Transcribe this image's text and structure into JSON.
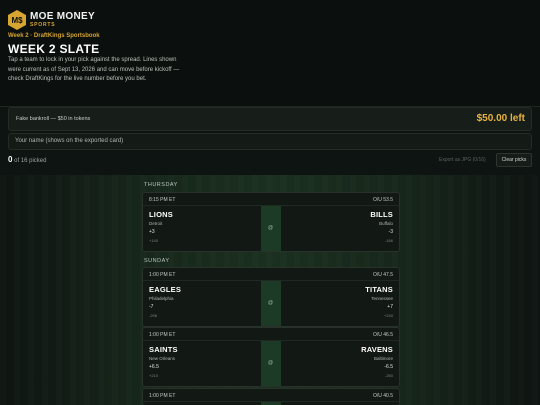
{
  "brand": {
    "badge": "M$",
    "name": "MOE MONEY",
    "sub": "SPORTS"
  },
  "header": {
    "eyebrow": "Week 2 · DraftKings Sportsbook",
    "title": "WEEK 2 SLATE",
    "description": "Tap a team to lock in your pick against the spread. Lines shown were current as of Sept 13, 2026 and can move before kickoff — check DraftKings for the live number before you bet."
  },
  "bankroll": {
    "label": "Fake bankroll — $50 in tokens",
    "amount": "$50.00 left"
  },
  "name_input": {
    "placeholder": "Your name (shows on the exported card)"
  },
  "picks": {
    "count": "0",
    "of_text": "of 16 picked",
    "export_label": "Export as JPG (0/16)",
    "clear_label": "Clear picks"
  },
  "days": {
    "thursday": "THURSDAY",
    "sunday": "SUNDAY"
  },
  "games": [
    {
      "time": "8:15 PM ET",
      "ou": "O/U 53.5",
      "at": "@",
      "away": {
        "team": "LIONS",
        "city": "Detroit",
        "spread": "+3",
        "ml": "+140"
      },
      "home": {
        "team": "BILLS",
        "city": "Buffalo",
        "spread": "-3",
        "ml": "-166"
      }
    },
    {
      "time": "1:00 PM ET",
      "ou": "O/U 47.5",
      "at": "@",
      "away": {
        "team": "EAGLES",
        "city": "Philadelphia",
        "spread": "-7",
        "ml": "-298"
      },
      "home": {
        "team": "TITANS",
        "city": "Tennessee",
        "spread": "+7",
        "ml": "+240"
      }
    },
    {
      "time": "1:00 PM ET",
      "ou": "O/U 46.5",
      "at": "@",
      "away": {
        "team": "SAINTS",
        "city": "New Orleans",
        "spread": "+6.5",
        "ml": "+210"
      },
      "home": {
        "team": "RAVENS",
        "city": "Baltimore",
        "spread": "-6.5",
        "ml": "-260"
      }
    },
    {
      "time": "1:00 PM ET",
      "ou": "O/U 40.5"
    }
  ]
}
